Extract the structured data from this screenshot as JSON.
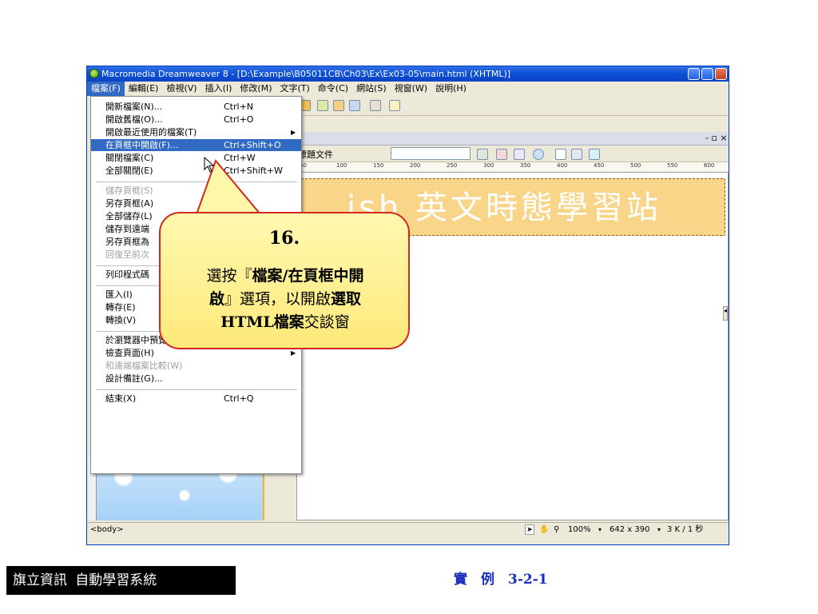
{
  "window": {
    "title": "Macromedia Dreamweaver 8 - [D:\\Example\\B05011CB\\Ch03\\Ex\\Ex03-05\\main.html (XHTML)]"
  },
  "menubar": [
    "檔案(F)",
    "編輯(E)",
    "檢視(V)",
    "插入(I)",
    "修改(M)",
    "文字(T)",
    "命令(C)",
    "網站(S)",
    "視窗(W)",
    "說明(H)"
  ],
  "file_menu": [
    {
      "label": "開新檔案(N)...",
      "shortcut": "Ctrl+N",
      "state": "normal"
    },
    {
      "label": "開啟舊檔(O)...",
      "shortcut": "Ctrl+O",
      "state": "normal"
    },
    {
      "label": "開啟最近使用的檔案(T)",
      "shortcut": "",
      "submenu": true,
      "state": "normal"
    },
    {
      "label": "在頁框中開啟(F)...",
      "shortcut": "Ctrl+Shift+O",
      "state": "highlight"
    },
    {
      "label": "關閉檔案(C)",
      "shortcut": "Ctrl+W",
      "state": "normal"
    },
    {
      "label": "全部關閉(E)",
      "shortcut": "Ctrl+Shift+W",
      "state": "normal"
    },
    {
      "label": "儲存頁框(S)",
      "shortcut": "",
      "state": "disabled"
    },
    {
      "label": "另存頁框(A)",
      "shortcut": "",
      "state": "normal"
    },
    {
      "label": "全部儲存(L)",
      "shortcut": "",
      "state": "normal"
    },
    {
      "label": "儲存到遠端",
      "shortcut": "",
      "state": "normal"
    },
    {
      "label": "另存頁框為",
      "shortcut": "",
      "state": "normal"
    },
    {
      "label": "回復至前次",
      "shortcut": "",
      "state": "disabled"
    },
    {
      "label": "列印程式碼",
      "shortcut": "",
      "state": "normal"
    },
    {
      "label": "匯入(I)",
      "shortcut": "",
      "state": "normal"
    },
    {
      "label": "轉存(E)",
      "shortcut": "",
      "state": "normal"
    },
    {
      "label": "轉換(V)",
      "shortcut": "",
      "submenu": true,
      "state": "normal"
    },
    {
      "label": "於瀏覽器中預覽(P)",
      "shortcut": "",
      "submenu": true,
      "state": "normal"
    },
    {
      "label": "檢查頁面(H)",
      "shortcut": "",
      "submenu": true,
      "state": "normal"
    },
    {
      "label": "和遠端檔案比較(W)",
      "shortcut": "",
      "state": "disabled"
    },
    {
      "label": "設計備註(G)...",
      "shortcut": "",
      "state": "normal"
    },
    {
      "label": "結束(X)",
      "shortcut": "Ctrl+Q",
      "state": "normal"
    }
  ],
  "doc": {
    "title_field": "標題文件",
    "banner_text": "ish 英文時態學習站",
    "ruler_ticks": [
      "50",
      "100",
      "150",
      "200",
      "250",
      "300",
      "350",
      "400",
      "450",
      "500",
      "550",
      "600"
    ]
  },
  "status": {
    "tag": "<body>",
    "zoom": "100%",
    "size": "642 x 390",
    "download": "3 K / 1 秒"
  },
  "callout": {
    "step": "16.",
    "line1_pre": "選按『",
    "line1_bold": "檔案/在頁框中開",
    "line2_bold": "啟",
    "line2_mid": "』選項，以開啟",
    "line2_bold2": "選取",
    "line3_bold": "HTML檔案",
    "line3_post": "交談窗"
  },
  "footer": {
    "left": "旗立資訊 自動學習系統",
    "right_prefix": "實　例　",
    "right_num": "3-2-1"
  },
  "colors": {
    "highlight": "#316ac5",
    "callout_border": "#d2281e",
    "banner": "#f9d58a",
    "footer_right": "#1a2fbf"
  }
}
